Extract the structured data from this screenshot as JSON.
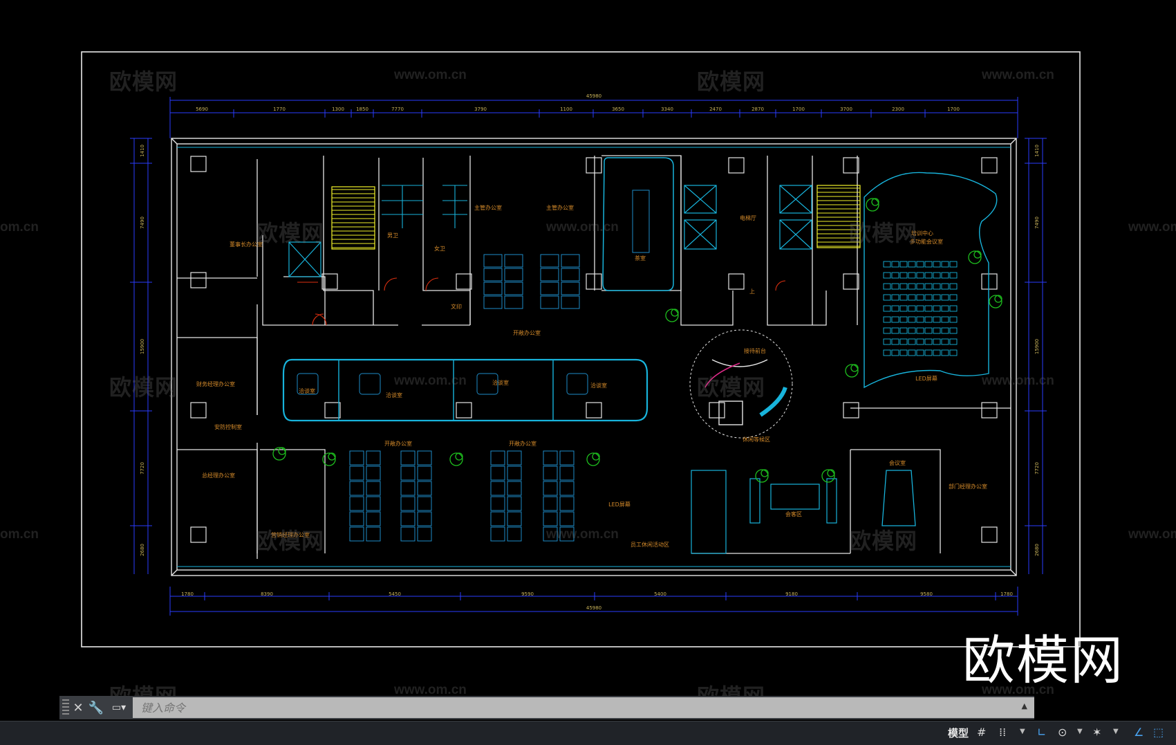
{
  "watermarks": {
    "brand": "欧模网",
    "url": "www.om.cn",
    "url_short": "om.cn",
    "big_logo": "欧模网"
  },
  "drawing": {
    "dims_top_total": "45980",
    "dims_bottom_total": "45980",
    "dims_top": [
      "5690",
      "1770",
      "1300",
      "1850",
      "7770",
      "3790",
      "1100",
      "3650",
      "3340",
      "2470",
      "2870",
      "1700",
      "3700",
      "2300",
      "1700"
    ],
    "dims_bottom": [
      "1780",
      "8390",
      "5450",
      "9590",
      "5400",
      "9180",
      "9580",
      "1780"
    ],
    "dims_left": [
      "1410",
      "7490",
      "15900",
      "7720",
      "2680"
    ],
    "dims_right": [
      "1410",
      "7490",
      "15900",
      "7720",
      "2680"
    ],
    "rooms": {
      "chairman_office": "董事长办公室",
      "finance_manager": "财务经理办公室",
      "gm_office": "总经理办公室",
      "sales_manager": "营销经理办公室",
      "control_room": "安防控制室",
      "male_wc": "男卫",
      "female_wc": "女卫",
      "director_office_1": "主管办公室",
      "director_office_2": "主管办公室",
      "tea_room": "茶室",
      "elevator_hall": "电梯厅",
      "training_center": "培训中心",
      "multi_meeting": "多功能会议室",
      "open_office_1": "开敞办公室",
      "open_office_2": "开敞办公室",
      "open_office_3": "开敞办公室",
      "discussion_1": "洽谈室",
      "discussion_2": "洽谈室",
      "discussion_3": "洽谈室",
      "discussion_4": "洽谈室",
      "reception": "接待前台",
      "waiting_area": "休闲等候区",
      "meeting_room": "会议室",
      "dept_manager": "部门经理办公室",
      "led_screen_1": "LED屏幕",
      "led_screen_2": "LED屏幕",
      "staff_area": "员工休闲活动区",
      "lounge": "会客区",
      "secretary": "文印",
      "female_wc_2": "女卫",
      "stair_up": "上"
    }
  },
  "command_bar": {
    "placeholder": "键入命令"
  },
  "status_bar": {
    "model_label": "模型"
  },
  "colors": {
    "wall": "#e6e6e6",
    "dimension": "#2a3cff",
    "furniture": "#1e8cc8",
    "glass": "#18b4dc",
    "stair": "#f2f22a",
    "plant": "#1ebe1e",
    "door": "#e03010",
    "label": "#d48a2a",
    "chair": "#6a5ad6"
  }
}
